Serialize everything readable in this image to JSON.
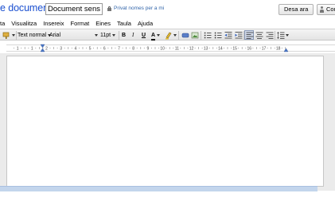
{
  "header": {
    "logo": "e documents",
    "doc_title": "Document sense títol",
    "privacy": "Privat nomes per a mi",
    "save_label": "Desa ara",
    "share_label": "Com"
  },
  "menu": [
    "ta",
    "Visualitza",
    "Insereix",
    "Format",
    "Eines",
    "Taula",
    "Ajuda"
  ],
  "toolbar": {
    "style": "Text normal",
    "font": "Arial",
    "size": "11pt",
    "bold": "B",
    "italic": "I",
    "underline": "U",
    "text_color": "A"
  },
  "ruler": {
    "labels": [
      "1",
      "1",
      "2",
      "3",
      "4",
      "5",
      "6",
      "7",
      "8",
      "9",
      "10",
      "11",
      "12",
      "13",
      "14",
      "15",
      "16",
      "17",
      "18"
    ]
  },
  "colors": {
    "link": "#3366cc",
    "bottom_bar": "#c3d5ec"
  }
}
